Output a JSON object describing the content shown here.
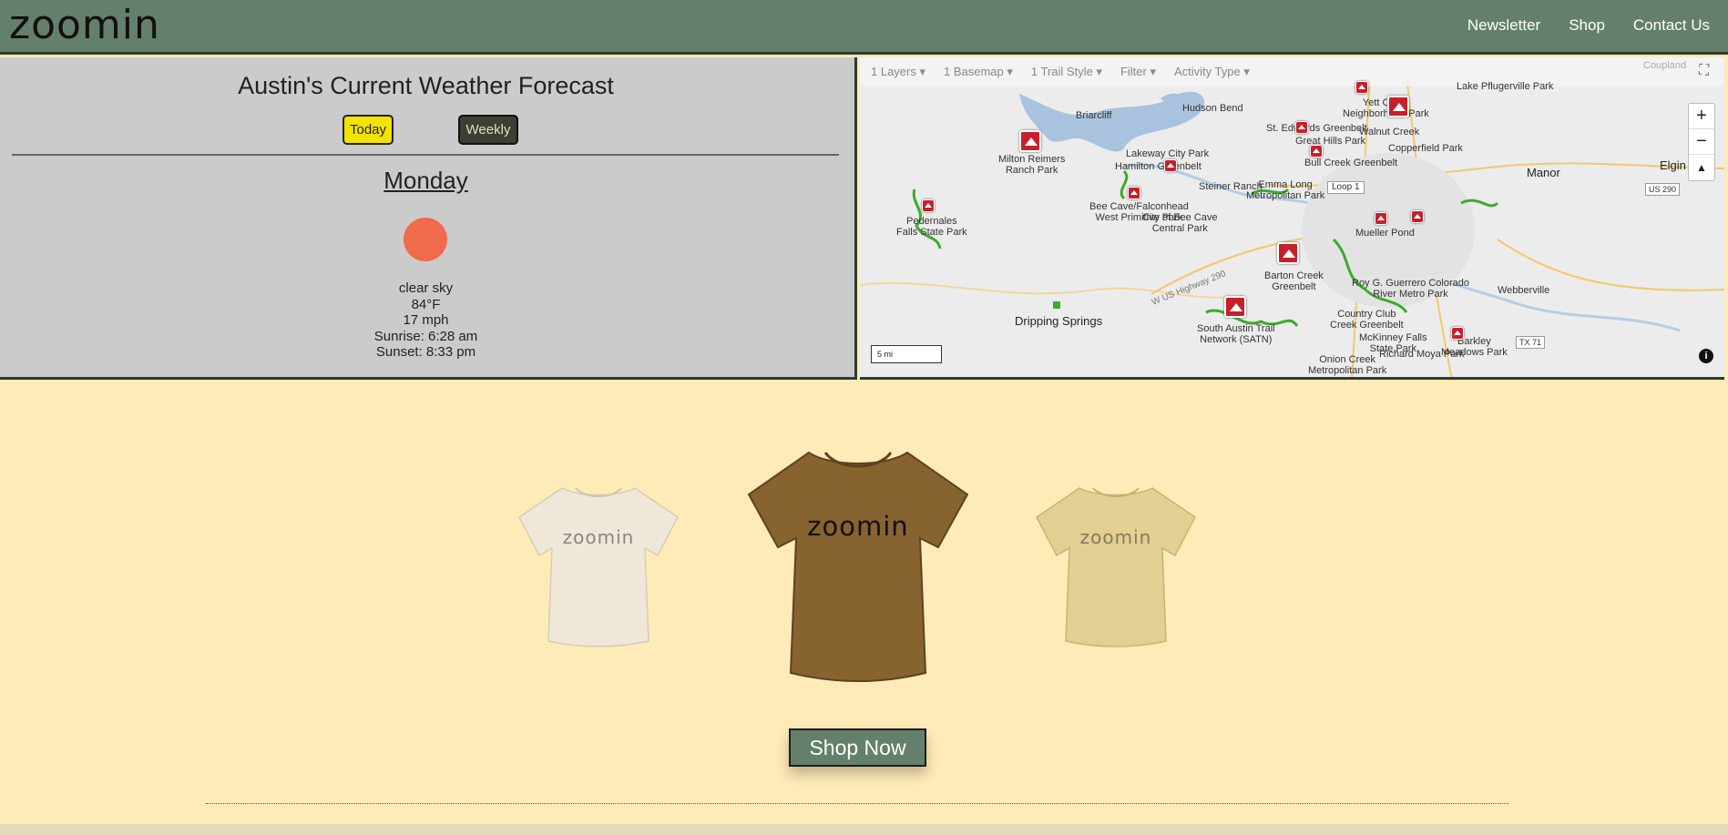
{
  "header": {
    "logo": "zoomin",
    "nav": [
      "Newsletter",
      "Shop",
      "Contact Us"
    ]
  },
  "weather": {
    "title": "Austin's Current Weather Forecast",
    "today_label": "Today",
    "weekly_label": "Weekly",
    "day": "Monday",
    "condition": "clear sky",
    "temperature": "84°F",
    "wind": "17 mph",
    "sunrise": "Sunrise: 6:28 am",
    "sunset": "Sunset: 8:33 pm",
    "sun_color": "#ef6b4b"
  },
  "map": {
    "toolbar": [
      "1 Layers ▾",
      "1 Basemap ▾",
      "1 Trail Style ▾",
      "Filter ▾",
      "Activity Type ▾"
    ],
    "zoom_in": "+",
    "zoom_out": "−",
    "compass": "▲",
    "scale": "5 mi",
    "labels": {
      "briarcliff": "Briarcliff",
      "hudson_bend": "Hudson Bend",
      "milton": "Milton Reimers\nRanch Park",
      "pedernales": "Pedernales\nFalls State Park",
      "lakeway": "Lakeway City Park",
      "hamilton": "Hamilton Greenbelt",
      "steiner": "Steiner Ranch",
      "bee_cave": "Bee Cave/Falconhead\nWest Primitive Park",
      "city_bee": "City of Bee Cave\nCentral Park",
      "dripping": "Dripping Springs",
      "barton": "Barton Creek\nGreenbelt",
      "satn": "South Austin Trail\nNetwork (SATN)",
      "emma": "Emma Long\nMetropolitan Park",
      "bull_creek": "Bull Creek Greenbelt",
      "great_hills": "Great Hills Park",
      "st_edwards": "St. Edwards Greenbelt",
      "walnut": "Walnut Creek",
      "copperfield": "Copperfield Park",
      "manor": "Manor",
      "elgin": "Elgin",
      "lake_pflug": "Lake Pflugerville Park",
      "webberville": "Webberville",
      "mueller": "Mueller Pond",
      "roy": "Roy G. Guerrero Colorado\nRiver Metro Park",
      "country_club": "Country Club\nCreek Greenbelt",
      "mckinney": "McKinney Falls\nState Park",
      "onion": "Onion Creek\nMetropolitan Park",
      "barkley": "Barkley\nMeadows Park",
      "richard": "Richard Moya Park",
      "loop1": "Loop 1",
      "us290": "US 290",
      "tx71": "TX 71",
      "yett": "Yett Creek\nNeighborhood Park",
      "coupland": "Coupland",
      "hwy290": "W US Highway 290"
    }
  },
  "shop": {
    "shirt_text": "zoomin",
    "shop_label": "Shop Now",
    "colors": {
      "cream": "#efe8d8",
      "brown": "#876330",
      "tan": "#e3cf92"
    }
  }
}
